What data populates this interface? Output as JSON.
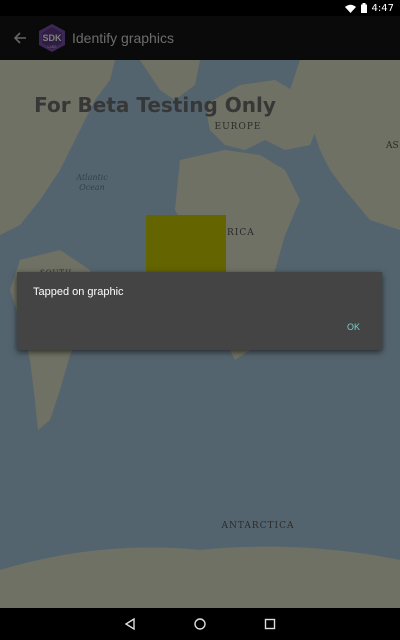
{
  "status_bar": {
    "time": "4:47",
    "icons": [
      "wifi-icon",
      "battery-icon"
    ]
  },
  "app_bar": {
    "title": "Identify graphics",
    "back_icon": "arrow-back-icon",
    "logo_text": "SDK",
    "logo_subtext": "LABS"
  },
  "map": {
    "watermark": "For Beta Testing Only",
    "labels": {
      "europe": "EUROPE",
      "asia_partial": "AS",
      "atlantic_line1": "Atlantic",
      "atlantic_line2": "Ocean",
      "africa_partial": "RICA",
      "south_america_partial": "SOUTH",
      "antarctica": "ANTARCTICA"
    },
    "graphic_color": "#c8c800"
  },
  "dialog": {
    "message": "Tapped on graphic",
    "ok_label": "OK"
  },
  "nav_bar": {
    "buttons": [
      "back-triangle-icon",
      "home-circle-icon",
      "recents-square-icon"
    ]
  },
  "colors": {
    "ocean": "#a9c8dc",
    "land": "#dfe3c9",
    "scrim": "rgba(0,0,0,0.5)",
    "dialog_bg": "#444444",
    "accent": "#80cbc4"
  }
}
